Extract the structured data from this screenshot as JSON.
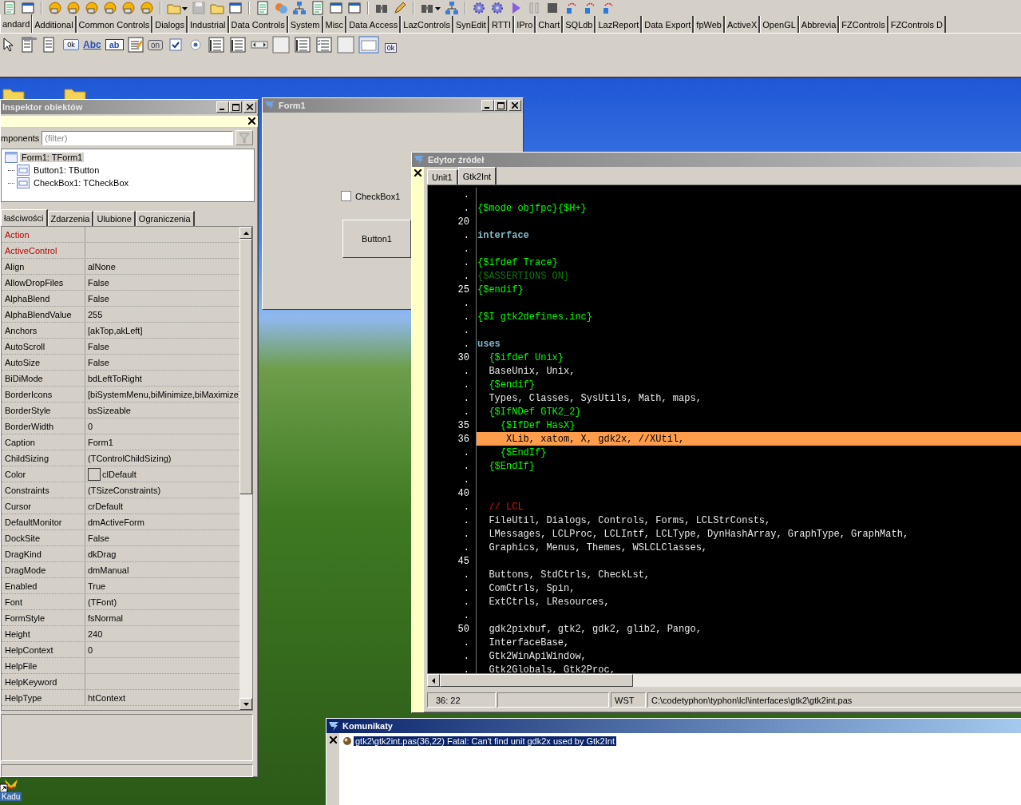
{
  "palette_tabs": [
    {
      "label": "andard",
      "selected": true
    },
    {
      "label": "Additional",
      "selected": false
    },
    {
      "label": "Common Controls",
      "selected": false
    },
    {
      "label": "Dialogs",
      "selected": false
    },
    {
      "label": "Industrial",
      "selected": false
    },
    {
      "label": "Data Controls",
      "selected": false
    },
    {
      "label": "System",
      "selected": false
    },
    {
      "label": "Misc",
      "selected": false
    },
    {
      "label": "Data Access",
      "selected": false
    },
    {
      "label": "LazControls",
      "selected": false
    },
    {
      "label": "SynEdit",
      "selected": false
    },
    {
      "label": "RTTI",
      "selected": false
    },
    {
      "label": "IPro",
      "selected": false
    },
    {
      "label": "Chart",
      "selected": false
    },
    {
      "label": "SQLdb",
      "selected": false
    },
    {
      "label": "LazReport",
      "selected": false
    },
    {
      "label": "Data Export",
      "selected": false
    },
    {
      "label": "fpWeb",
      "selected": false
    },
    {
      "label": "ActiveX",
      "selected": false
    },
    {
      "label": "OpenGL",
      "selected": false
    },
    {
      "label": "Abbrevia",
      "selected": false
    },
    {
      "label": "FZControls",
      "selected": false
    },
    {
      "label": "FZControls D",
      "selected": false
    }
  ],
  "palette_components": [
    {
      "kind": "pointer"
    },
    {
      "kind": "menu"
    },
    {
      "kind": "popup"
    },
    {
      "kind": "button",
      "label": "0k"
    },
    {
      "kind": "label",
      "label": "Abc"
    },
    {
      "kind": "edit",
      "label": "ab"
    },
    {
      "kind": "memo"
    },
    {
      "kind": "toggle",
      "label": "on"
    },
    {
      "kind": "checkbox"
    },
    {
      "kind": "radio"
    },
    {
      "kind": "list"
    },
    {
      "kind": "list"
    },
    {
      "kind": "scrollbar"
    },
    {
      "kind": "panel"
    },
    {
      "kind": "list"
    },
    {
      "kind": "checklist"
    },
    {
      "kind": "panel"
    },
    {
      "kind": "frame"
    },
    {
      "kind": "actions",
      "label": "0k"
    }
  ],
  "desktop_icons": [
    {
      "kind": "folder"
    },
    {
      "kind": "folder"
    },
    {
      "kind": "star",
      "label": "Kadu"
    }
  ],
  "inspector": {
    "title": "Inspektor obiektów",
    "filter_label": "mponents",
    "filter": {
      "placeholder": "(filter)"
    },
    "tree": [
      {
        "label": "Form1: TForm1",
        "selected": true,
        "children": [
          {
            "label": "Button1: TButton",
            "selected": false
          },
          {
            "label": "CheckBox1: TCheckBox",
            "selected": false
          }
        ]
      }
    ],
    "tabs": [
      {
        "label": "łaściwości",
        "selected": true
      },
      {
        "label": "Zdarzenia",
        "selected": false
      },
      {
        "label": "Ulubione",
        "selected": false
      },
      {
        "label": "Ograniczenia",
        "selected": false
      }
    ],
    "properties": [
      {
        "name": "Action",
        "kind": "reference"
      },
      {
        "name": "ActiveControl",
        "kind": "reference"
      },
      {
        "name": "Align",
        "value": "alNone",
        "kind": "plain"
      },
      {
        "name": "AllowDropFiles",
        "value": "False",
        "kind": "plain"
      },
      {
        "name": "AlphaBlend",
        "value": "False",
        "kind": "plain"
      },
      {
        "name": "AlphaBlendValue",
        "value": "255",
        "kind": "plain"
      },
      {
        "name": "Anchors",
        "value": "[akTop,akLeft]",
        "kind": "plain"
      },
      {
        "name": "AutoScroll",
        "value": "False",
        "kind": "plain"
      },
      {
        "name": "AutoSize",
        "value": "False",
        "kind": "plain"
      },
      {
        "name": "BiDiMode",
        "value": "bdLeftToRight",
        "kind": "plain"
      },
      {
        "name": "BorderIcons",
        "value": "[biSystemMenu,biMinimize,biMaximize]",
        "kind": "plain"
      },
      {
        "name": "BorderStyle",
        "value": "bsSizeable",
        "kind": "plain"
      },
      {
        "name": "BorderWidth",
        "value": "0",
        "kind": "plain"
      },
      {
        "name": "Caption",
        "value": "Form1",
        "kind": "plain"
      },
      {
        "name": "ChildSizing",
        "value": "(TControlChildSizing)",
        "kind": "plain"
      },
      {
        "name": "Color",
        "value": "clDefault",
        "kind": "color"
      },
      {
        "name": "Constraints",
        "value": "(TSizeConstraints)",
        "kind": "plain"
      },
      {
        "name": "Cursor",
        "value": "crDefault",
        "kind": "plain"
      },
      {
        "name": "DefaultMonitor",
        "value": "dmActiveForm",
        "kind": "plain"
      },
      {
        "name": "DockSite",
        "value": "False",
        "kind": "plain"
      },
      {
        "name": "DragKind",
        "value": "dkDrag",
        "kind": "plain"
      },
      {
        "name": "DragMode",
        "value": "dmManual",
        "kind": "plain"
      },
      {
        "name": "Enabled",
        "value": "True",
        "kind": "plain"
      },
      {
        "name": "Font",
        "value": "(TFont)",
        "kind": "plain"
      },
      {
        "name": "FormStyle",
        "value": "fsNormal",
        "kind": "plain"
      },
      {
        "name": "Height",
        "value": "240",
        "kind": "plain"
      },
      {
        "name": "HelpContext",
        "value": "0",
        "kind": "plain"
      },
      {
        "name": "HelpFile",
        "kind": "plain"
      },
      {
        "name": "HelpKeyword",
        "kind": "plain"
      },
      {
        "name": "HelpType",
        "value": "htContext",
        "kind": "plain"
      }
    ]
  },
  "form": {
    "title": "Form1",
    "checkbox": {
      "label": "CheckBox1",
      "checked": false
    },
    "button": "Button1"
  },
  "editor": {
    "title": "Edytor źródeł",
    "tabs": [
      {
        "label": "Unit1",
        "selected": false
      },
      {
        "label": "Gtk2Int",
        "selected": true
      }
    ],
    "lines": [
      {
        "gutter": "."
      },
      {
        "gutter": ".",
        "code": "{$mode objfpc}{$H+}",
        "kind": "directive"
      },
      {
        "gutter": "20"
      },
      {
        "gutter": ".",
        "code": "interface",
        "kind": "keyword"
      },
      {
        "gutter": "."
      },
      {
        "gutter": ".",
        "code": "{$ifdef Trace}",
        "kind": "directive"
      },
      {
        "gutter": ".",
        "code": "{$ASSERTIONS ON}",
        "kind": "disabled"
      },
      {
        "gutter": "25",
        "code": "{$endif}",
        "kind": "directive"
      },
      {
        "gutter": "."
      },
      {
        "gutter": ".",
        "code": "{$I gtk2defines.inc}",
        "kind": "directive"
      },
      {
        "gutter": "."
      },
      {
        "gutter": ".",
        "code": "uses",
        "kind": "keyword"
      },
      {
        "gutter": "30",
        "code": "  {$ifdef Unix}",
        "kind": "directive"
      },
      {
        "gutter": ".",
        "code": "  BaseUnix, Unix,",
        "kind": "text"
      },
      {
        "gutter": ".",
        "code": "  {$endif}",
        "kind": "directive"
      },
      {
        "gutter": ".",
        "code": "  Types, Classes, SysUtils, Math, maps,",
        "kind": "text"
      },
      {
        "gutter": ".",
        "code": "  {$IfNDef GTK2_2}",
        "kind": "directive"
      },
      {
        "gutter": "35",
        "code": "    {$IfDef HasX}",
        "kind": "directive"
      },
      {
        "gutter": "36",
        "code": "     XLib, xatom, X, gdk2x, //XUtil,",
        "kind": "error"
      },
      {
        "gutter": ".",
        "code": "    {$EndIf}",
        "kind": "directive"
      },
      {
        "gutter": ".",
        "code": "  {$EndIf}",
        "kind": "directive"
      },
      {
        "gutter": "."
      },
      {
        "gutter": "40"
      },
      {
        "gutter": ".",
        "code": "  // LCL",
        "kind": "comment"
      },
      {
        "gutter": ".",
        "code": "  FileUtil, Dialogs, Controls, Forms, LCLStrConsts,",
        "kind": "text"
      },
      {
        "gutter": ".",
        "code": "  LMessages, LCLProc, LCLIntf, LCLType, DynHashArray, GraphType, GraphMath,",
        "kind": "text"
      },
      {
        "gutter": ".",
        "code": "  Graphics, Menus, Themes, WSLCLClasses,",
        "kind": "text"
      },
      {
        "gutter": "45"
      },
      {
        "gutter": ".",
        "code": "  Buttons, StdCtrls, CheckLst,",
        "kind": "text"
      },
      {
        "gutter": ".",
        "code": "  ComCtrls, Spin,",
        "kind": "text"
      },
      {
        "gutter": ".",
        "code": "  ExtCtrls, LResources,",
        "kind": "text"
      },
      {
        "gutter": "."
      },
      {
        "gutter": "50",
        "code": "  gdk2pixbuf, gtk2, gdk2, glib2, Pango,",
        "kind": "text"
      },
      {
        "gutter": ".",
        "code": "  InterfaceBase,",
        "kind": "text"
      },
      {
        "gutter": ".",
        "code": "  Gtk2WinApiWindow,",
        "kind": "text"
      },
      {
        "gutter": ".",
        "code": "  Gtk2Globals, Gtk2Proc,",
        "kind": "text"
      }
    ],
    "status": {
      "position": "36: 22",
      "mode": "WST",
      "file": "C:\\codetyphon\\typhon\\lcl\\interfaces\\gtk2\\gtk2int.pas"
    }
  },
  "messages": {
    "title": "Komunikaty",
    "items": [
      {
        "text": "gtk2\\gtk2int.pas(36,22) Fatal: Can't find unit gdk2x used by Gtk2Int",
        "selected": true
      }
    ]
  }
}
